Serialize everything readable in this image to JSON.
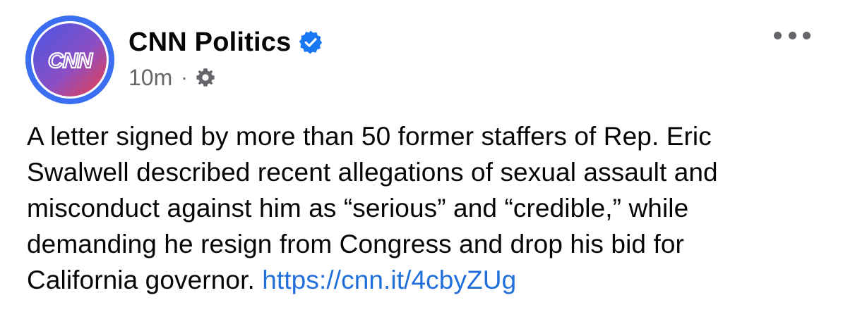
{
  "post": {
    "page_name": "CNN Politics",
    "avatar_label": "CNN",
    "verified_icon": "verified-badge-icon",
    "timestamp": "10m",
    "separator": "·",
    "audience_icon": "globe-gear-icon",
    "more_icon": "more-options-icon",
    "body_lines": [
      "A letter signed by more than 50 former staffers of Rep. Eric",
      "Swalwell described recent allegations of sexual assault and",
      "misconduct against him as “serious” and “credible,” while",
      "demanding he resign from Congress and drop his bid for",
      "California governor."
    ],
    "link": "https://cnn.it/4cbyZUg"
  },
  "colors": {
    "verified_blue": "#1877f2",
    "link_blue": "#216fdb",
    "meta_gray": "#65676b",
    "avatar_ring": "#3b6ef0",
    "logo_gradient_start": "#4a57e6",
    "logo_gradient_end": "#ef3e4a"
  }
}
